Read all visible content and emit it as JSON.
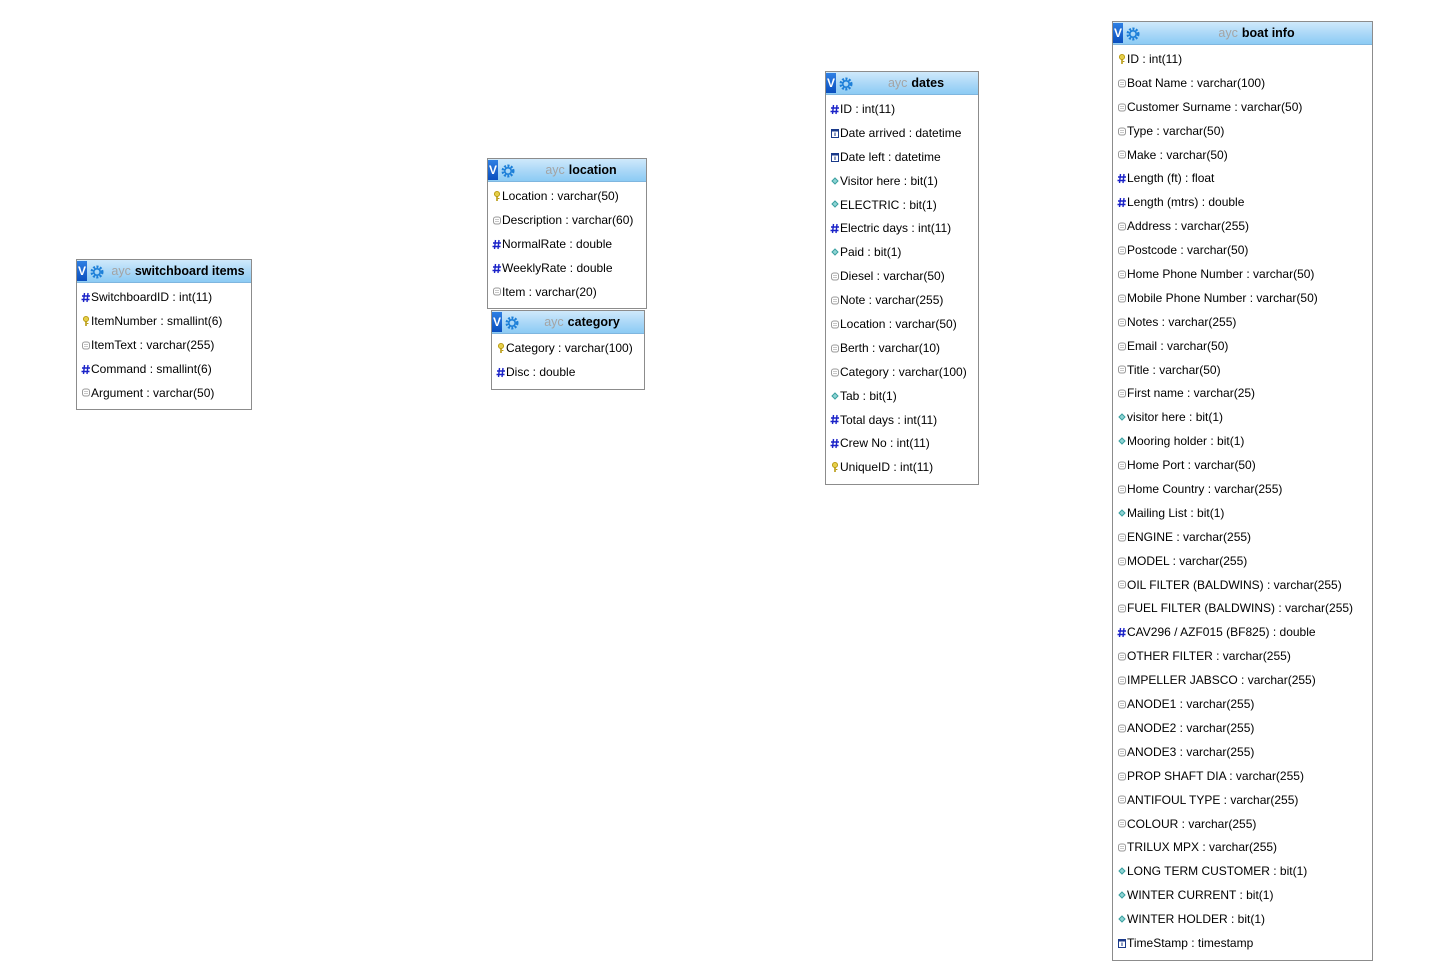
{
  "tables": [
    {
      "id": "switchboard-items",
      "toggle": "V",
      "db": "ayc",
      "name": "switchboard items",
      "columns": [
        {
          "text": "SwitchboardID : int(11)",
          "kind": "num"
        },
        {
          "text": "ItemNumber : smallint(6)",
          "kind": "key"
        },
        {
          "text": "ItemText : varchar(255)",
          "kind": "str"
        },
        {
          "text": "Command : smallint(6)",
          "kind": "num"
        },
        {
          "text": "Argument : varchar(50)",
          "kind": "str"
        }
      ]
    },
    {
      "id": "location",
      "toggle": "V",
      "db": "ayc",
      "name": "location",
      "columns": [
        {
          "text": "Location : varchar(50)",
          "kind": "key"
        },
        {
          "text": "Description : varchar(60)",
          "kind": "str"
        },
        {
          "text": "NormalRate : double",
          "kind": "num"
        },
        {
          "text": "WeeklyRate : double",
          "kind": "num"
        },
        {
          "text": "Item : varchar(20)",
          "kind": "str"
        }
      ]
    },
    {
      "id": "category",
      "toggle": "V",
      "db": "ayc",
      "name": "category",
      "columns": [
        {
          "text": "Category : varchar(100)",
          "kind": "key"
        },
        {
          "text": "Disc : double",
          "kind": "num"
        }
      ]
    },
    {
      "id": "dates",
      "toggle": "V",
      "db": "ayc",
      "name": "dates",
      "columns": [
        {
          "text": "ID : int(11)",
          "kind": "num"
        },
        {
          "text": "Date arrived : datetime",
          "kind": "date"
        },
        {
          "text": "Date left : datetime",
          "kind": "date"
        },
        {
          "text": "Visitor here : bit(1)",
          "kind": "bit"
        },
        {
          "text": "ELECTRIC : bit(1)",
          "kind": "bit"
        },
        {
          "text": "Electric days : int(11)",
          "kind": "num"
        },
        {
          "text": "Paid : bit(1)",
          "kind": "bit"
        },
        {
          "text": "Diesel : varchar(50)",
          "kind": "str"
        },
        {
          "text": "Note : varchar(255)",
          "kind": "str"
        },
        {
          "text": "Location : varchar(50)",
          "kind": "str"
        },
        {
          "text": "Berth : varchar(10)",
          "kind": "str"
        },
        {
          "text": "Category : varchar(100)",
          "kind": "str"
        },
        {
          "text": "Tab : bit(1)",
          "kind": "bit"
        },
        {
          "text": "Total days : int(11)",
          "kind": "num"
        },
        {
          "text": "Crew No : int(11)",
          "kind": "num"
        },
        {
          "text": "UniqueID : int(11)",
          "kind": "key"
        }
      ]
    },
    {
      "id": "boat-info",
      "toggle": "V",
      "db": "ayc",
      "name": "boat info",
      "columns": [
        {
          "text": "ID : int(11)",
          "kind": "key"
        },
        {
          "text": "Boat Name : varchar(100)",
          "kind": "str"
        },
        {
          "text": "Customer Surname : varchar(50)",
          "kind": "str"
        },
        {
          "text": "Type : varchar(50)",
          "kind": "str"
        },
        {
          "text": "Make : varchar(50)",
          "kind": "str"
        },
        {
          "text": "Length (ft) : float",
          "kind": "num"
        },
        {
          "text": "Length (mtrs) : double",
          "kind": "num"
        },
        {
          "text": "Address : varchar(255)",
          "kind": "str"
        },
        {
          "text": "Postcode : varchar(50)",
          "kind": "str"
        },
        {
          "text": "Home Phone Number : varchar(50)",
          "kind": "str"
        },
        {
          "text": "Mobile Phone Number : varchar(50)",
          "kind": "str"
        },
        {
          "text": "Notes : varchar(255)",
          "kind": "str"
        },
        {
          "text": "Email : varchar(50)",
          "kind": "str"
        },
        {
          "text": "Title : varchar(50)",
          "kind": "str"
        },
        {
          "text": "First name : varchar(25)",
          "kind": "str"
        },
        {
          "text": "visitor here : bit(1)",
          "kind": "bit"
        },
        {
          "text": "Mooring holder : bit(1)",
          "kind": "bit"
        },
        {
          "text": "Home Port : varchar(50)",
          "kind": "str"
        },
        {
          "text": "Home Country : varchar(255)",
          "kind": "str"
        },
        {
          "text": "Mailing List : bit(1)",
          "kind": "bit"
        },
        {
          "text": "ENGINE : varchar(255)",
          "kind": "str"
        },
        {
          "text": "MODEL : varchar(255)",
          "kind": "str"
        },
        {
          "text": "OIL FILTER (BALDWINS) : varchar(255)",
          "kind": "str"
        },
        {
          "text": "FUEL FILTER (BALDWINS) : varchar(255)",
          "kind": "str"
        },
        {
          "text": "CAV296 / AZF015 (BF825) : double",
          "kind": "num"
        },
        {
          "text": "OTHER FILTER : varchar(255)",
          "kind": "str"
        },
        {
          "text": "IMPELLER JABSCO : varchar(255)",
          "kind": "str"
        },
        {
          "text": "ANODE1 : varchar(255)",
          "kind": "str"
        },
        {
          "text": "ANODE2 : varchar(255)",
          "kind": "str"
        },
        {
          "text": "ANODE3 : varchar(255)",
          "kind": "str"
        },
        {
          "text": "PROP SHAFT DIA : varchar(255)",
          "kind": "str"
        },
        {
          "text": "ANTIFOUL TYPE : varchar(255)",
          "kind": "str"
        },
        {
          "text": "COLOUR : varchar(255)",
          "kind": "str"
        },
        {
          "text": "TRILUX MPX : varchar(255)",
          "kind": "str"
        },
        {
          "text": "LONG TERM CUSTOMER : bit(1)",
          "kind": "bit"
        },
        {
          "text": "WINTER CURRENT : bit(1)",
          "kind": "bit"
        },
        {
          "text": "WINTER HOLDER : bit(1)",
          "kind": "bit"
        },
        {
          "text": "TimeStamp : timestamp",
          "kind": "date"
        }
      ]
    }
  ],
  "icons": {
    "num": "hash-icon",
    "key": "primary-key-icon",
    "str": "text-field-icon",
    "bit": "bit-field-icon",
    "date": "date-field-icon"
  },
  "colors": {
    "header_light": "#cfe9fb",
    "header_dark": "#8ccbf4",
    "toggle": "#0a4fbf",
    "db_prefix": "#a4a4a4",
    "border": "#8c8c8c",
    "hash": "#1a22c8",
    "key": "#b89a10",
    "bit": "#3aa0a0"
  }
}
